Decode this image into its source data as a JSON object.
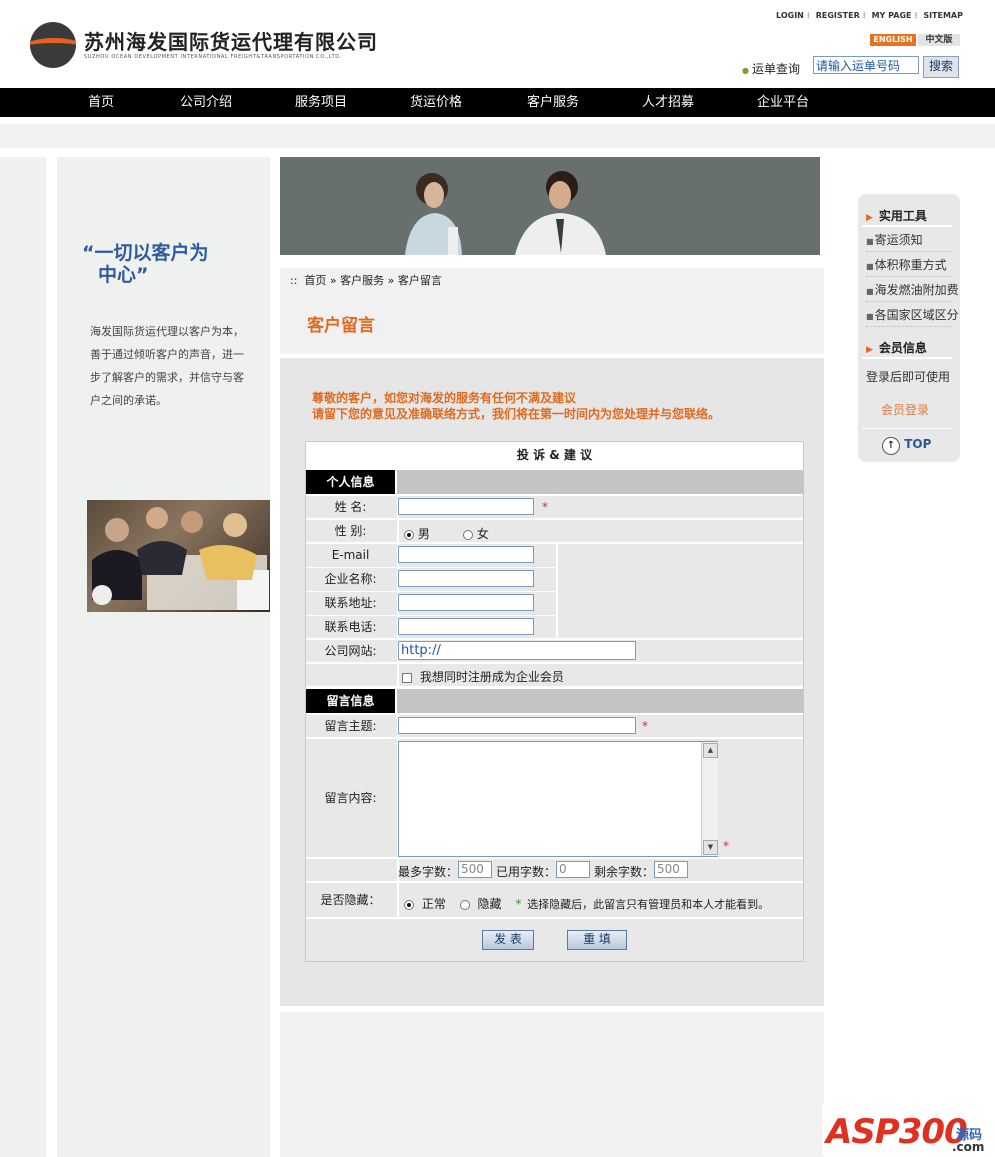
{
  "header": {
    "company_cn": "苏州海发国际货运代理有限公司",
    "company_en": "SUZHOU OCEAN DEVELOPMENT INTERNATIONAL FREIGHT&TRANSPORTATION CO.,LTD.",
    "top_links": [
      "LOGIN",
      "REGISTER",
      "MY PAGE",
      "SITEMAP"
    ],
    "lang_en": "ENGLISH",
    "lang_cn": "中文版",
    "track_label": "运单查询",
    "track_placeholder": "请输入运单号码",
    "search_label": "搜索"
  },
  "nav": [
    "首页",
    "公司介绍",
    "服务项目",
    "货运价格",
    "客户服务",
    "人才招募",
    "企业平台"
  ],
  "left": {
    "slogan_line1": "“一切以客户为",
    "slogan_line2": "中心”",
    "intro": "海发国际货运代理以客户为本，善于通过倾听客户的声音，进一步了解客户的需求，并信守与客户之间的承诺。"
  },
  "breadcrumb": {
    "prefix": "::",
    "items": [
      "首页",
      "客户服务",
      "客户留言"
    ],
    "sep": "»"
  },
  "page_title": "客户留言",
  "notice": {
    "line1": "尊敬的客户，如您对海发的服务有任何不满及建议",
    "line2": "请留下您的意见及准确联络方式，我们将在第一时间内为您处理并与您联络。"
  },
  "form": {
    "title": "投 诉 & 建 议",
    "section_personal": "个人信息",
    "name_label": "姓  名:",
    "gender_label": "性  别:",
    "gender_male": "男",
    "gender_female": "女",
    "email_label": "E-mail",
    "company_label": "企业名称:",
    "address_label": "联系地址:",
    "phone_label": "联系电话:",
    "website_label": "公司网站:",
    "website_value": "http://",
    "register_label": "我想同时注册成为企业会员",
    "section_message": "留言信息",
    "subject_label": "留言主题:",
    "content_label": "留言内容:",
    "required_mark": "*",
    "max_chars_label": "最多字数：",
    "max_chars": "500",
    "used_chars_label": "已用字数：",
    "used_chars": "0",
    "remaining_label": "剩余字数：",
    "remaining": "500",
    "hidden_label": "是否隐藏：",
    "normal": "正常",
    "hidden": "隐藏",
    "hidden_note": "选择隐藏后，此留言只有管理员和本人才能看到。",
    "submit": "发 表",
    "reset": "重 填"
  },
  "sidebar": {
    "tools_title": "实用工具",
    "tools": [
      "寄运须知",
      "体积称重方式",
      "海发燃油附加费",
      "各国家区域区分"
    ],
    "member_title": "会员信息",
    "member_note": "登录后即可使用",
    "member_login": "会员登录",
    "top": "TOP"
  },
  "watermark": {
    "text": "ASP300",
    "sub1": "源码",
    "sub2": ".com"
  },
  "colors": {
    "accent": "#e06a20",
    "nav_bg": "#000000",
    "link_blue": "#2d5aa0"
  }
}
